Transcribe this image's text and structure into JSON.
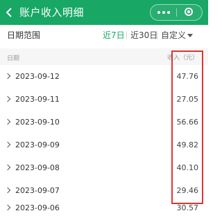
{
  "header": {
    "title": "账户收入明细",
    "back_icon": "chevron-left-icon",
    "more_icon": "more-dots-icon",
    "close_icon": "target-close-icon",
    "bg_color": "#18a765"
  },
  "filter": {
    "label": "日期范围",
    "tabs": [
      {
        "label": "近7日",
        "active": true
      },
      {
        "label": "近30日",
        "active": false
      },
      {
        "label": "自定义",
        "active": false
      }
    ],
    "accent_color": "#18a765"
  },
  "table": {
    "columns": {
      "date": "日期",
      "amount": "收入（元）"
    },
    "rows": [
      {
        "date": "2023-09-12",
        "amount": "47.76"
      },
      {
        "date": "2023-09-11",
        "amount": "27.05"
      },
      {
        "date": "2023-09-10",
        "amount": "56.66"
      },
      {
        "date": "2023-09-09",
        "amount": "49.82"
      },
      {
        "date": "2023-09-08",
        "amount": "40.10"
      },
      {
        "date": "2023-09-07",
        "amount": "29.46"
      },
      {
        "date": "2023-09-06",
        "amount": "30.57"
      }
    ]
  },
  "highlight_color": "#e0342f"
}
